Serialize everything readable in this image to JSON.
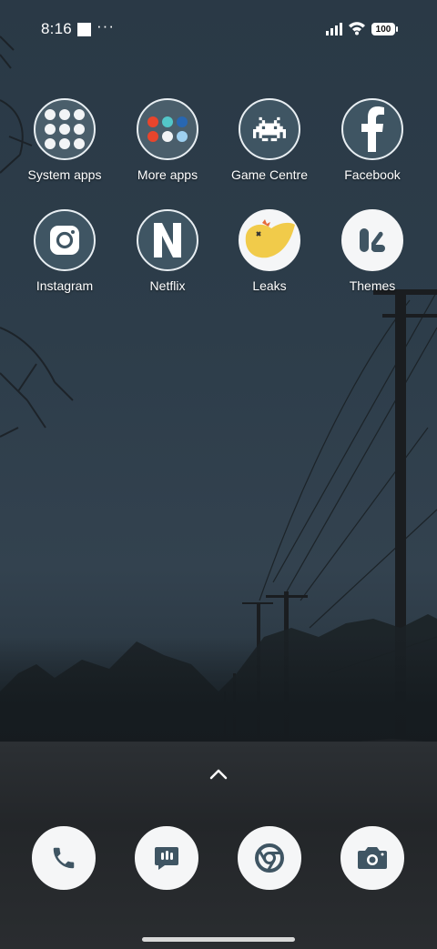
{
  "status": {
    "time": "8:16",
    "more_indicator": "···",
    "battery": "100"
  },
  "apps": [
    {
      "label": "System apps",
      "icon": "folder-icon"
    },
    {
      "label": "More apps",
      "icon": "folder-icon"
    },
    {
      "label": "Game Centre",
      "icon": "space-invader-icon"
    },
    {
      "label": "Facebook",
      "icon": "facebook-icon"
    },
    {
      "label": "Instagram",
      "icon": "instagram-icon"
    },
    {
      "label": "Netflix",
      "icon": "netflix-icon"
    },
    {
      "label": "Leaks",
      "icon": "bird-icon"
    },
    {
      "label": "Themes",
      "icon": "themes-icon"
    }
  ],
  "dock": [
    {
      "icon": "phone-icon"
    },
    {
      "icon": "messages-icon"
    },
    {
      "icon": "chrome-icon"
    },
    {
      "icon": "camera-icon"
    }
  ],
  "colors": {
    "icon_bg": "#3f5563",
    "icon_border": "#e8eef2",
    "leaks_yellow": "#f1cb4a"
  }
}
